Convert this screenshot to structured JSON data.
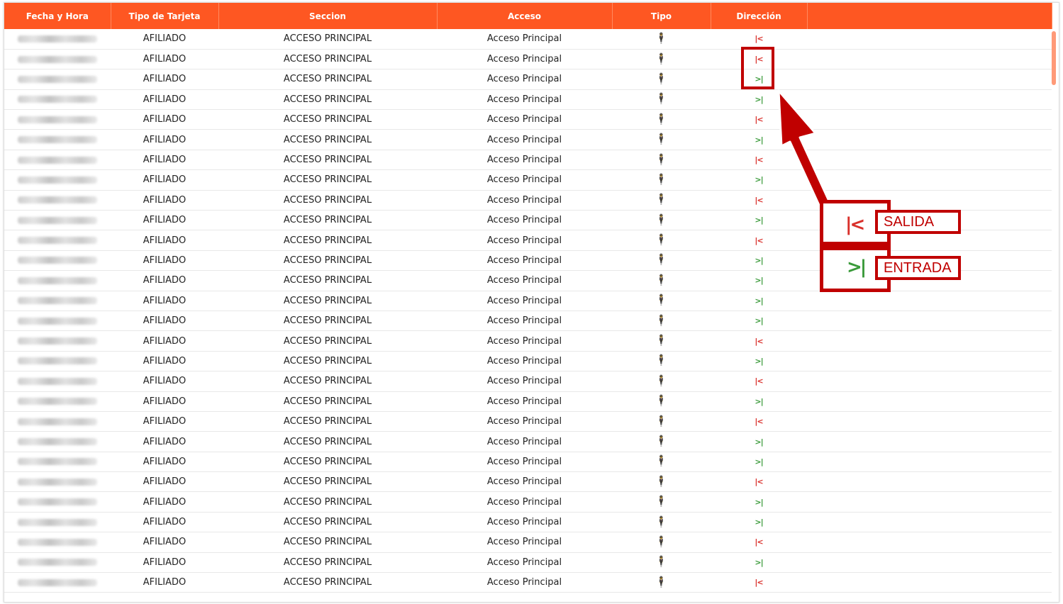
{
  "table": {
    "headers": [
      "Fecha y Hora",
      "Tipo de Tarjeta",
      "Seccion",
      "Acceso",
      "Tipo",
      "Dirección"
    ],
    "rows": [
      {
        "tarjeta": "AFILIADO",
        "seccion": "ACCESO PRINCIPAL",
        "acceso": "Acceso Principal",
        "dir": "out"
      },
      {
        "tarjeta": "AFILIADO",
        "seccion": "ACCESO PRINCIPAL",
        "acceso": "Acceso Principal",
        "dir": "out"
      },
      {
        "tarjeta": "AFILIADO",
        "seccion": "ACCESO PRINCIPAL",
        "acceso": "Acceso Principal",
        "dir": "in"
      },
      {
        "tarjeta": "AFILIADO",
        "seccion": "ACCESO PRINCIPAL",
        "acceso": "Acceso Principal",
        "dir": "in"
      },
      {
        "tarjeta": "AFILIADO",
        "seccion": "ACCESO PRINCIPAL",
        "acceso": "Acceso Principal",
        "dir": "out"
      },
      {
        "tarjeta": "AFILIADO",
        "seccion": "ACCESO PRINCIPAL",
        "acceso": "Acceso Principal",
        "dir": "in"
      },
      {
        "tarjeta": "AFILIADO",
        "seccion": "ACCESO PRINCIPAL",
        "acceso": "Acceso Principal",
        "dir": "out"
      },
      {
        "tarjeta": "AFILIADO",
        "seccion": "ACCESO PRINCIPAL",
        "acceso": "Acceso Principal",
        "dir": "in"
      },
      {
        "tarjeta": "AFILIADO",
        "seccion": "ACCESO PRINCIPAL",
        "acceso": "Acceso Principal",
        "dir": "out"
      },
      {
        "tarjeta": "AFILIADO",
        "seccion": "ACCESO PRINCIPAL",
        "acceso": "Acceso Principal",
        "dir": "in"
      },
      {
        "tarjeta": "AFILIADO",
        "seccion": "ACCESO PRINCIPAL",
        "acceso": "Acceso Principal",
        "dir": "out"
      },
      {
        "tarjeta": "AFILIADO",
        "seccion": "ACCESO PRINCIPAL",
        "acceso": "Acceso Principal",
        "dir": "in"
      },
      {
        "tarjeta": "AFILIADO",
        "seccion": "ACCESO PRINCIPAL",
        "acceso": "Acceso Principal",
        "dir": "in"
      },
      {
        "tarjeta": "AFILIADO",
        "seccion": "ACCESO PRINCIPAL",
        "acceso": "Acceso Principal",
        "dir": "in"
      },
      {
        "tarjeta": "AFILIADO",
        "seccion": "ACCESO PRINCIPAL",
        "acceso": "Acceso Principal",
        "dir": "in"
      },
      {
        "tarjeta": "AFILIADO",
        "seccion": "ACCESO PRINCIPAL",
        "acceso": "Acceso Principal",
        "dir": "out"
      },
      {
        "tarjeta": "AFILIADO",
        "seccion": "ACCESO PRINCIPAL",
        "acceso": "Acceso Principal",
        "dir": "in"
      },
      {
        "tarjeta": "AFILIADO",
        "seccion": "ACCESO PRINCIPAL",
        "acceso": "Acceso Principal",
        "dir": "out"
      },
      {
        "tarjeta": "AFILIADO",
        "seccion": "ACCESO PRINCIPAL",
        "acceso": "Acceso Principal",
        "dir": "in"
      },
      {
        "tarjeta": "AFILIADO",
        "seccion": "ACCESO PRINCIPAL",
        "acceso": "Acceso Principal",
        "dir": "out"
      },
      {
        "tarjeta": "AFILIADO",
        "seccion": "ACCESO PRINCIPAL",
        "acceso": "Acceso Principal",
        "dir": "in"
      },
      {
        "tarjeta": "AFILIADO",
        "seccion": "ACCESO PRINCIPAL",
        "acceso": "Acceso Principal",
        "dir": "in"
      },
      {
        "tarjeta": "AFILIADO",
        "seccion": "ACCESO PRINCIPAL",
        "acceso": "Acceso Principal",
        "dir": "out"
      },
      {
        "tarjeta": "AFILIADO",
        "seccion": "ACCESO PRINCIPAL",
        "acceso": "Acceso Principal",
        "dir": "in"
      },
      {
        "tarjeta": "AFILIADO",
        "seccion": "ACCESO PRINCIPAL",
        "acceso": "Acceso Principal",
        "dir": "in"
      },
      {
        "tarjeta": "AFILIADO",
        "seccion": "ACCESO PRINCIPAL",
        "acceso": "Acceso Principal",
        "dir": "out"
      },
      {
        "tarjeta": "AFILIADO",
        "seccion": "ACCESO PRINCIPAL",
        "acceso": "Acceso Principal",
        "dir": "in"
      },
      {
        "tarjeta": "AFILIADO",
        "seccion": "ACCESO PRINCIPAL",
        "acceso": "Acceso Principal",
        "dir": "out"
      }
    ]
  },
  "icons": {
    "tipo": "person-standing-icon",
    "out": "exit-direction-icon",
    "in": "entry-direction-icon"
  },
  "glyphs": {
    "tipo": "🕴",
    "out": "|<",
    "in": ">|"
  },
  "legend": {
    "salida": "SALIDA",
    "entrada": "ENTRADA"
  },
  "colors": {
    "header": "#fe5722",
    "out": "#d9302b",
    "in": "#3a9a3a",
    "annotation": "#c00000"
  }
}
